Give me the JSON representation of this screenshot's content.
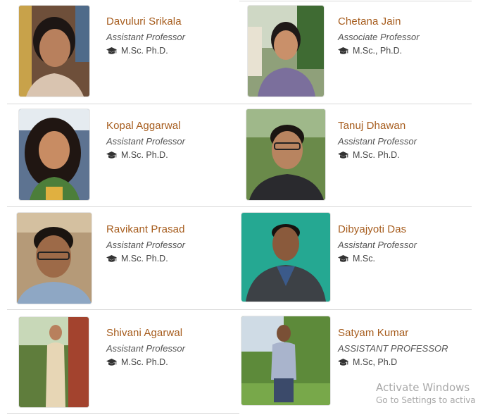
{
  "faculty": [
    {
      "name": "Davuluri Srikala",
      "title": "Assistant Professor",
      "degree": "M.Sc. Ph.D."
    },
    {
      "name": "Chetana Jain",
      "title": "Associate Professor",
      "degree": "M.Sc., Ph.D."
    },
    {
      "name": "Kopal Aggarwal",
      "title": "Assistant Professor",
      "degree": "M.Sc. Ph.D."
    },
    {
      "name": "Tanuj Dhawan",
      "title": "Assistant Professor",
      "degree": "M.Sc. Ph.D."
    },
    {
      "name": "Ravikant Prasad",
      "title": "Assistant Professor",
      "degree": "M.Sc. Ph.D."
    },
    {
      "name": "Dibyajyoti Das",
      "title": "Assistant Professor",
      "degree": "M.Sc."
    },
    {
      "name": "Shivani Agarwal",
      "title": "Assistant Professor",
      "degree": "M.Sc. Ph.D."
    },
    {
      "name": "Satyam Kumar",
      "title": "ASSISTANT PROFESSOR",
      "degree": "M.Sc, Ph.D"
    }
  ],
  "watermark": {
    "line1": "Activate Windows",
    "line2": "Go to Settings to activa"
  },
  "icons": {
    "degree": "graduation-cap-icon"
  }
}
